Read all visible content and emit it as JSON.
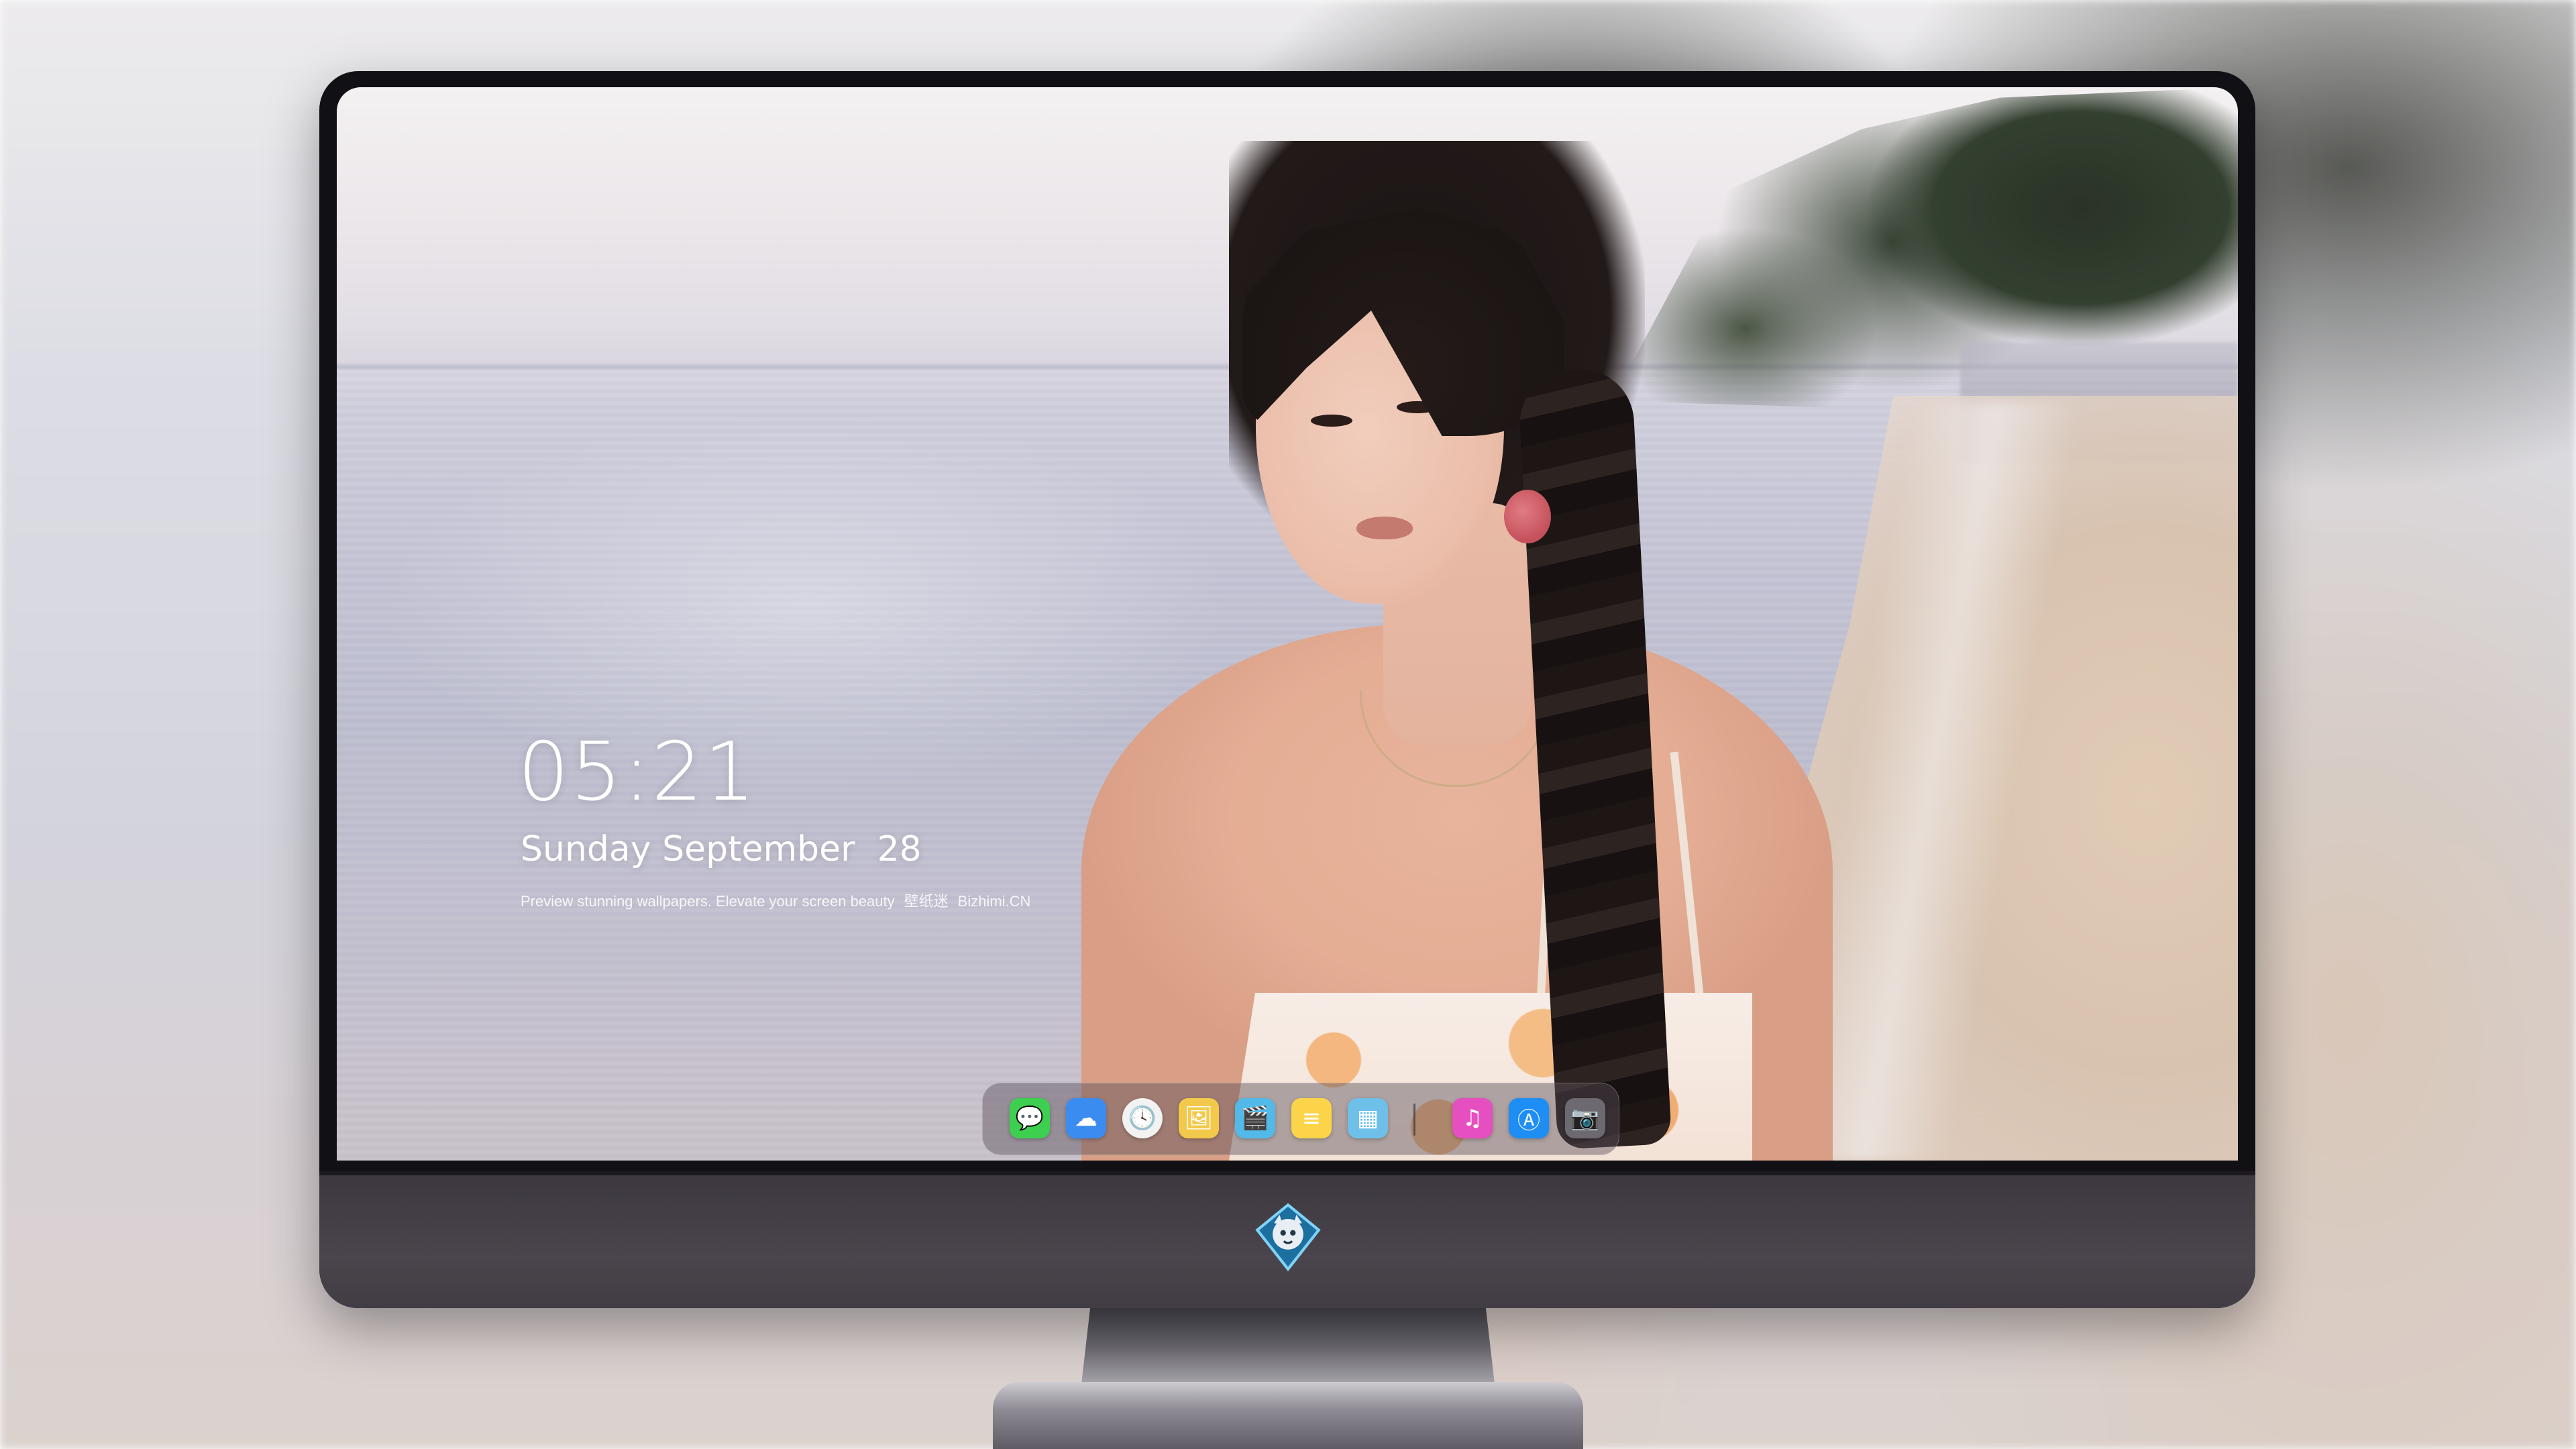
{
  "lockscreen": {
    "time": "05:21",
    "date": "Sunday September  28",
    "tagline": "Preview stunning wallpapers. Elevate your screen beauty",
    "brand_cn": "壁纸迷",
    "brand_url": "Bizhimi.CN"
  },
  "dock": {
    "apps": [
      {
        "name": "messages",
        "icon": "message-bubble-icon",
        "glyph": "💬",
        "color": "#3dcf4f"
      },
      {
        "name": "weather",
        "icon": "cloud-icon",
        "glyph": "☁",
        "color": "#3b8cf0"
      },
      {
        "name": "clock",
        "icon": "clock-icon",
        "glyph": "🕓",
        "color": "#f2f2f2"
      },
      {
        "name": "preview",
        "icon": "preview-icon",
        "glyph": "🖼",
        "color": "#f3c94b"
      },
      {
        "name": "clips",
        "icon": "clapperboard-icon",
        "glyph": "🎬",
        "color": "#52b9e9"
      },
      {
        "name": "notes",
        "icon": "notes-icon",
        "glyph": "≡",
        "color": "#fbd44a"
      },
      {
        "name": "photo-booth",
        "icon": "photos-icon",
        "glyph": "▦",
        "color": "#6ec0e8"
      },
      {
        "name": "music",
        "icon": "music-note-icon",
        "glyph": "♫",
        "color": "#e64fbf"
      },
      {
        "name": "app-store",
        "icon": "app-store-icon",
        "glyph": "Ⓐ",
        "color": "#1e8ef5"
      },
      {
        "name": "camera",
        "icon": "camera-icon",
        "glyph": "📷",
        "color": "#6c6a70"
      }
    ]
  },
  "colors": {
    "bezel": "#111014",
    "chin": "#4a454c",
    "text": "#ffffff"
  }
}
